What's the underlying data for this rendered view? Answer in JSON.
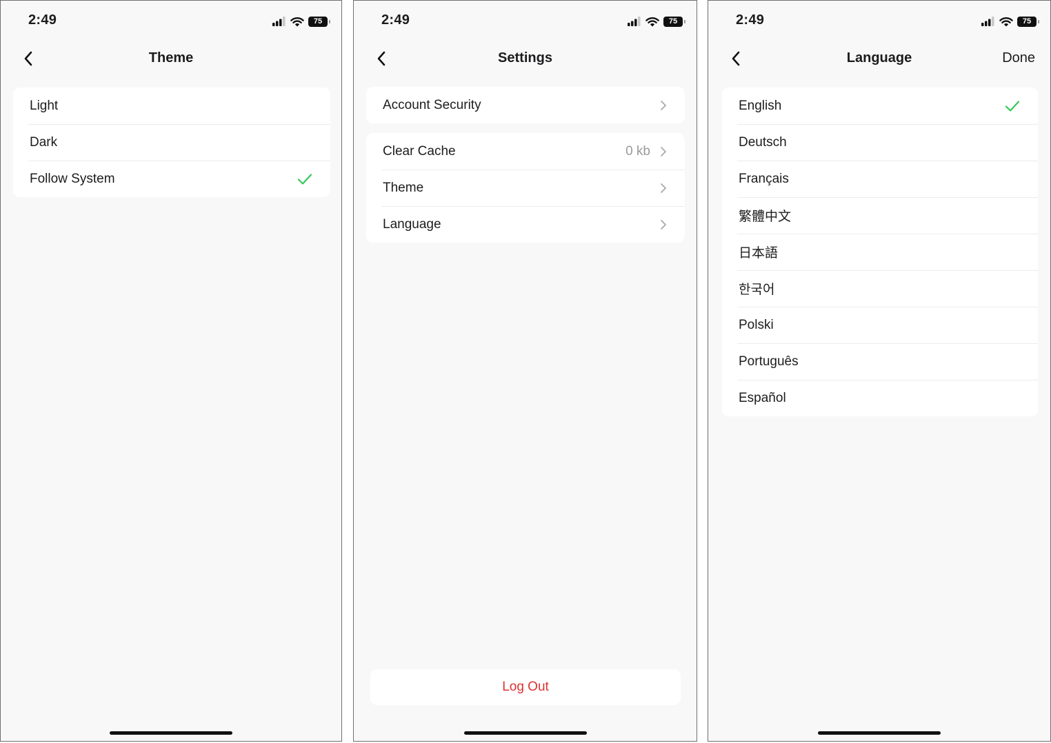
{
  "status": {
    "time": "2:49",
    "battery": "75"
  },
  "colors": {
    "accent_check": "#34c759",
    "destructive": "#e03131",
    "background": "#f8f8f8",
    "card": "#ffffff"
  },
  "theme_screen": {
    "title": "Theme",
    "options": [
      {
        "label": "Light",
        "selected": false
      },
      {
        "label": "Dark",
        "selected": false
      },
      {
        "label": "Follow System",
        "selected": true
      }
    ]
  },
  "settings_screen": {
    "title": "Settings",
    "group1": [
      {
        "label": "Account Security"
      }
    ],
    "group2": [
      {
        "label": "Clear Cache",
        "value": "0 kb"
      },
      {
        "label": "Theme"
      },
      {
        "label": "Language"
      }
    ],
    "logout_label": "Log Out"
  },
  "language_screen": {
    "title": "Language",
    "done_label": "Done",
    "options": [
      {
        "label": "English",
        "selected": true
      },
      {
        "label": "Deutsch",
        "selected": false
      },
      {
        "label": "Français",
        "selected": false
      },
      {
        "label": "繁體中文",
        "selected": false
      },
      {
        "label": "日本語",
        "selected": false
      },
      {
        "label": "한국어",
        "selected": false
      },
      {
        "label": "Polski",
        "selected": false
      },
      {
        "label": "Português",
        "selected": false
      },
      {
        "label": "Español",
        "selected": false
      }
    ]
  },
  "icons": {
    "back": "chevron-left-icon",
    "disclosure": "chevron-right-icon",
    "check": "checkmark-icon",
    "signal": "cellular-signal-icon",
    "wifi": "wifi-icon",
    "battery": "battery-icon"
  }
}
